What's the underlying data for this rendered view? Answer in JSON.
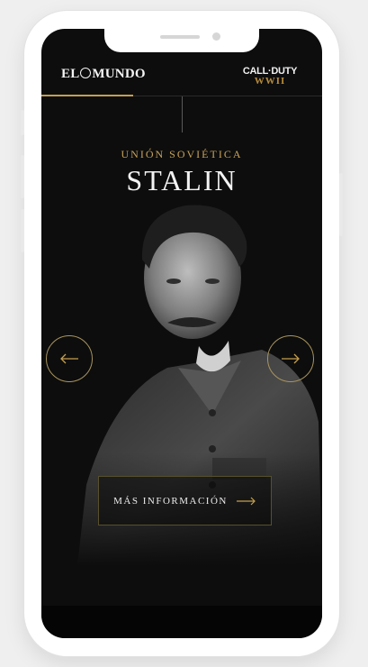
{
  "header": {
    "brand_left": "EL MUNDO",
    "brand_left_part1": "EL",
    "brand_left_part2": "MUNDO",
    "brand_right_main": "CALL·DUTY",
    "brand_right_sub": "WWII"
  },
  "hero": {
    "subtitle": "UNIÓN SOVIÉTICA",
    "title": "STALIN"
  },
  "navigation": {
    "prev_icon": "arrow-left-icon",
    "next_icon": "arrow-right-icon"
  },
  "cta": {
    "label": "MÁS INFORMACIÓN",
    "icon": "arrow-right-icon"
  },
  "colors": {
    "accent": "#c59f4e",
    "background": "#0d0d0d",
    "text": "#f2f2f2"
  }
}
